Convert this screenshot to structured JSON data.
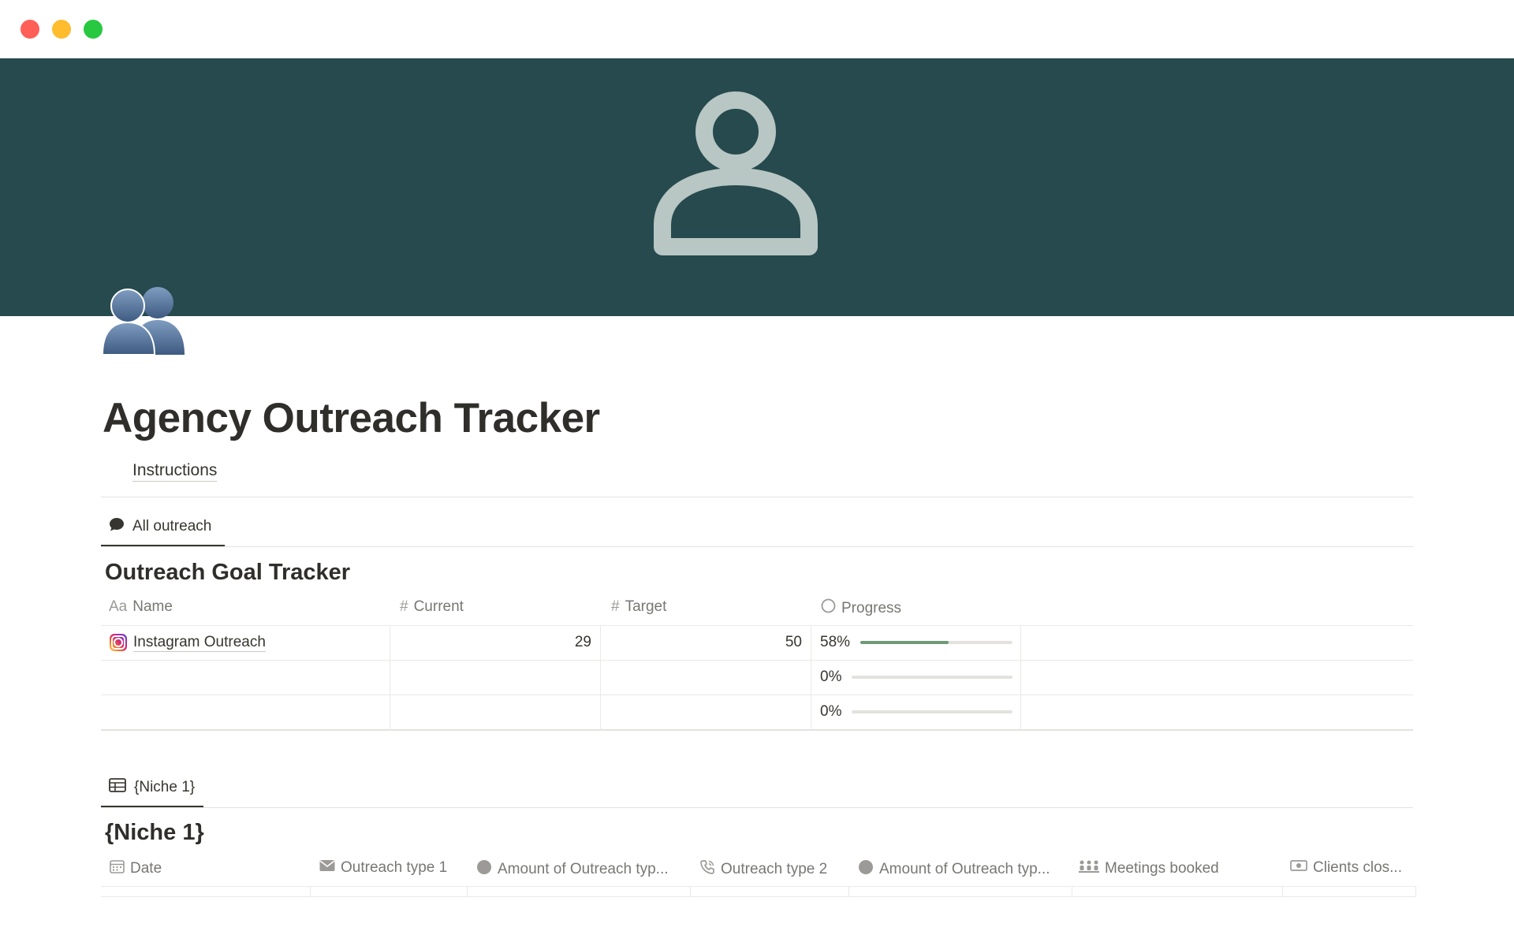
{
  "colors": {
    "cover_bg": "#264a4d",
    "cover_figure": "#b8c7c4",
    "progress_fill": "#6f9a76",
    "progress_track": "#e3e2df"
  },
  "page": {
    "title": "Agency Outreach Tracker",
    "icon": "busts-in-silhouette-icon",
    "instructions_label": "Instructions"
  },
  "goal_tracker": {
    "tab_label": "All outreach",
    "title": "Outreach Goal Tracker",
    "columns": {
      "name": "Name",
      "name_icon_glyph": "Aa",
      "current": "Current",
      "target": "Target",
      "progress": "Progress"
    },
    "rows": [
      {
        "name": "Instagram Outreach",
        "icon": "instagram-icon",
        "current": "29",
        "target": "50",
        "progress_label": "58%",
        "progress": 0.58
      },
      {
        "name": "",
        "current": "",
        "target": "",
        "progress_label": "0%",
        "progress": 0
      },
      {
        "name": "",
        "current": "",
        "target": "",
        "progress_label": "0%",
        "progress": 0
      }
    ]
  },
  "niche": {
    "tab_label": "{Niche 1}",
    "title": "{Niche 1}",
    "columns": [
      {
        "label": "Date",
        "icon": "calendar-icon"
      },
      {
        "label": "Outreach type 1",
        "icon": "envelope-icon"
      },
      {
        "label": "Amount of Outreach typ...",
        "icon": "circle-icon"
      },
      {
        "label": "Outreach type 2",
        "icon": "phone-icon"
      },
      {
        "label": "Amount of Outreach typ...",
        "icon": "circle-icon"
      },
      {
        "label": "Meetings booked",
        "icon": "people-icon"
      },
      {
        "label": "Clients clos...",
        "icon": "money-icon"
      }
    ]
  }
}
